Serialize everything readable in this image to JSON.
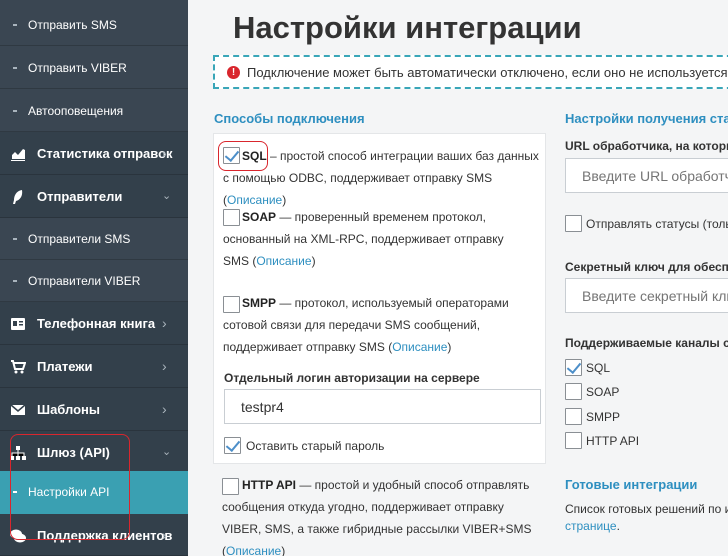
{
  "sidebar": {
    "items": [
      {
        "label": "Отправить SMS"
      },
      {
        "label": "Отправить VIBER"
      },
      {
        "label": "Автооповещения"
      },
      {
        "label": "Статистика отправок",
        "icon": "bar-chart-icon"
      },
      {
        "label": "Отправители",
        "icon": "feather-icon"
      },
      {
        "label": "Отправители SMS"
      },
      {
        "label": "Отправители VIBER"
      },
      {
        "label": "Телефонная книга",
        "icon": "address-book-icon"
      },
      {
        "label": "Платежи",
        "icon": "cart-icon"
      },
      {
        "label": "Шаблоны",
        "icon": "envelope-icon"
      },
      {
        "label": "Шлюз (API)",
        "icon": "sitemap-icon"
      },
      {
        "label": "Настройки API"
      },
      {
        "label": "Поддержка клиентов",
        "icon": "chat-icon"
      }
    ]
  },
  "page": {
    "title": "Настройки интеграции",
    "notice": "Подключение может быть автоматически отключено, если оно не используется"
  },
  "methods": {
    "title": "Способы подключения",
    "sql": {
      "name": "SQL",
      "desc": " – простой способ интеграции ваших баз данных с помощью ODBC, поддерживает отправку SMS (",
      "link": "Описание",
      "tail": ")",
      "checked": true
    },
    "soap": {
      "name": "SOAP",
      "desc": " — проверенный временем протокол, основанный на XML-RPC, поддерживает отправку SMS (",
      "link": "Описание",
      "tail": ")",
      "checked": false
    },
    "smpp": {
      "name": "SMPP",
      "desc": " — протокол, используемый операторами сотовой связи для передачи SMS сообщений, поддерживает отправку SMS (",
      "link": "Описание",
      "tail": ")",
      "checked": false
    },
    "login_label": "Отдельный логин авторизации на сервере",
    "login_value": "testpr4",
    "keep_password_label": "Оставить старый пароль",
    "keep_password_checked": true,
    "http": {
      "name": "HTTP API",
      "desc": " — простой и удобный способ отправлять сообщения откуда угодно, поддерживает отправку VIBER, SMS, а также гибридные рассылки VIBER+SMS (",
      "link": "Описание",
      "tail": ")",
      "checked": false
    }
  },
  "status_settings": {
    "title": "Настройки получения стат",
    "url_label": "URL обработчика, на который",
    "url_placeholder": "Введите URL обработч",
    "send_statuses_label": "Отправлять статусы (тольк",
    "secret_label": "Секретный ключ для обеспече",
    "secret_placeholder": "Введите секретный клю",
    "channels_label": "Поддерживаемые каналы созд",
    "channels": [
      {
        "label": "SQL",
        "checked": true
      },
      {
        "label": "SOAP",
        "checked": false
      },
      {
        "label": "SMPP",
        "checked": false
      },
      {
        "label": "HTTP API",
        "checked": false
      }
    ]
  },
  "ready": {
    "title": "Готовые интеграции",
    "line1": "Список готовых решений по и",
    "link": "странице",
    "line2_tail": "."
  },
  "colors": {
    "sidebar_bg": "#3a4652",
    "active": "#3aa0b2",
    "accent": "#2e8fc0",
    "highlight": "#d9262d"
  }
}
